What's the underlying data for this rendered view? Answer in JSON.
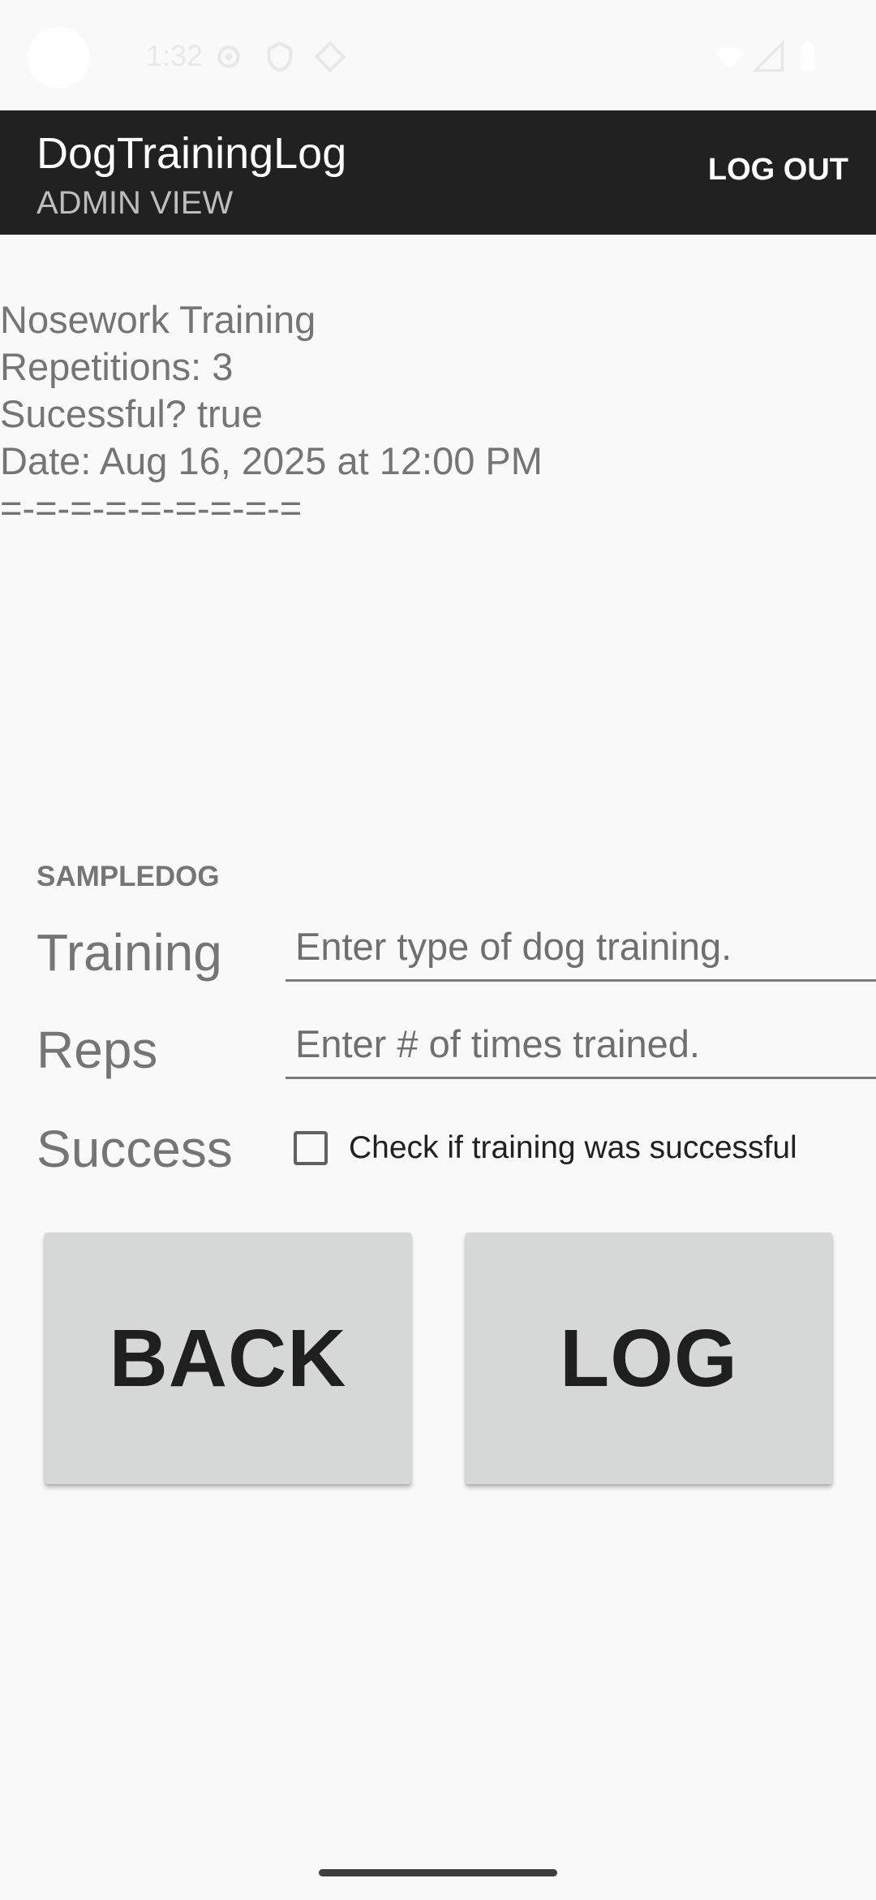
{
  "status_bar": {
    "time": "1:32",
    "icons": [
      "settings-icon",
      "vpn-shield-icon",
      "diamond-icon",
      "wifi-icon",
      "signal-icon",
      "battery-icon"
    ]
  },
  "app_bar": {
    "title": "DogTrainingLog",
    "subtitle": "ADMIN VIEW",
    "logout_label": "LOG OUT"
  },
  "log_entries": [
    "Nosework Training",
    "Repetitions: 3",
    "Sucessful? true",
    "Date: Aug 16, 2025 at 12:00 PM",
    "=-=-=-=-=-=-=-=-="
  ],
  "form": {
    "dog_name": "SAMPLEDOG",
    "training_label": "Training",
    "training_placeholder": "Enter type of dog training.",
    "reps_label": "Reps",
    "reps_placeholder": "Enter # of times trained.",
    "success_label": "Success",
    "success_checkbox_label": "Check if training was successful",
    "success_checked": false
  },
  "buttons": {
    "back_label": "BACK",
    "log_label": "LOG"
  },
  "colors": {
    "app_bar": "#212121",
    "background": "#f9f9f9",
    "button": "#d6d7d7"
  }
}
